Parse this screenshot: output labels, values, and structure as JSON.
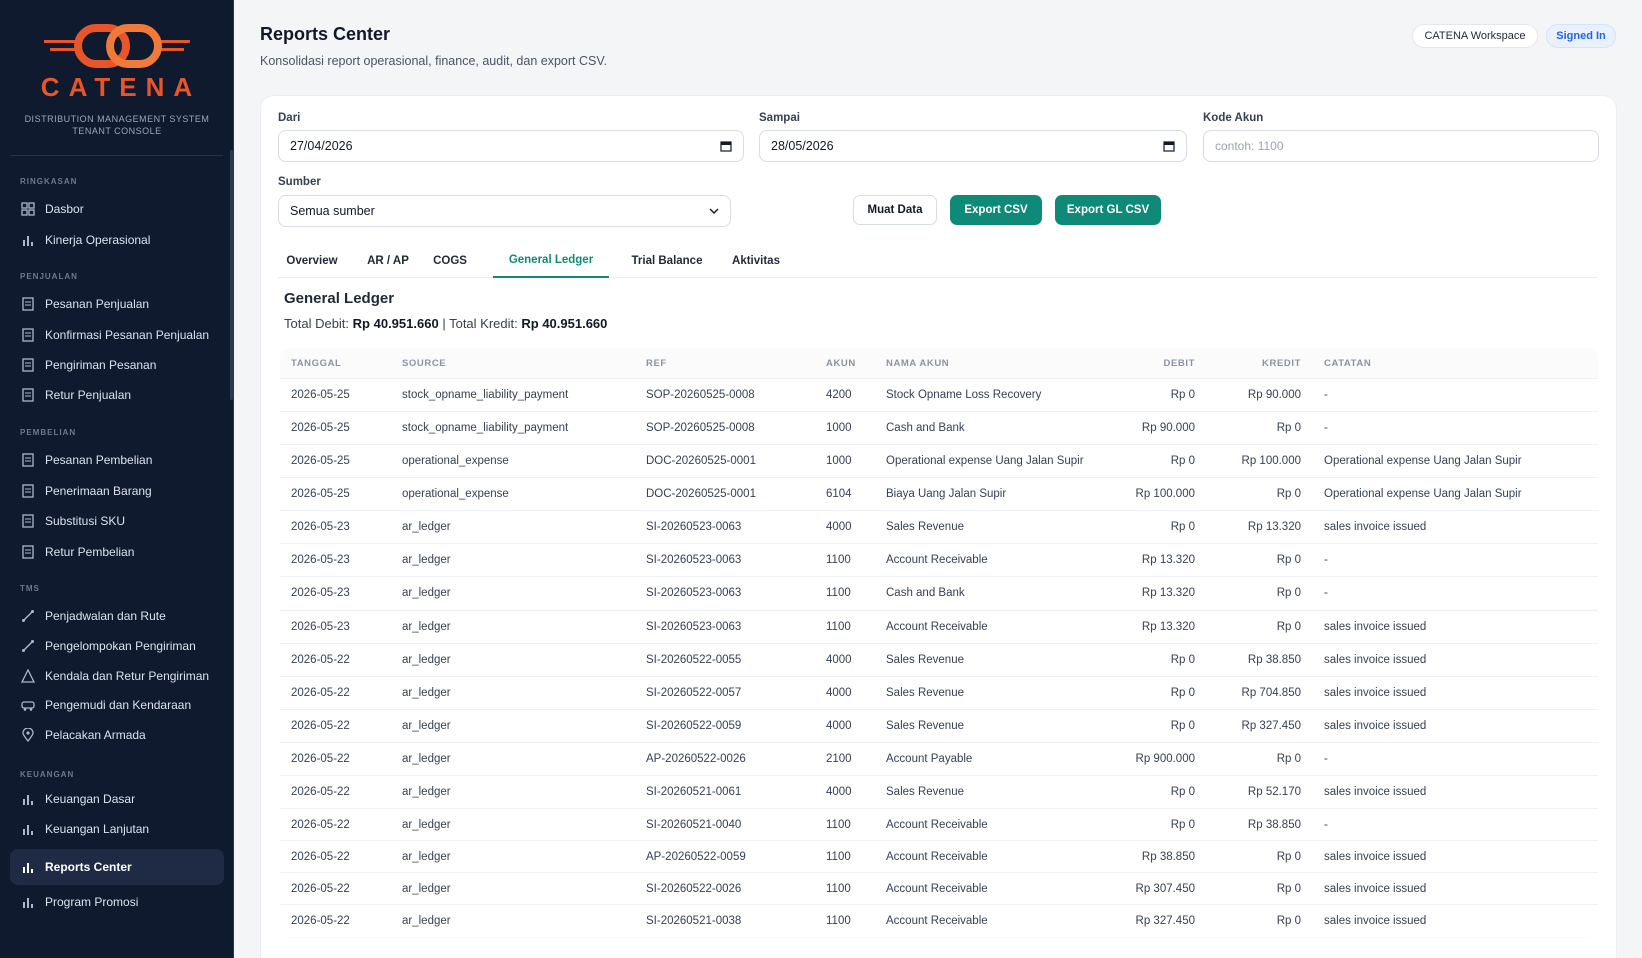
{
  "brand": {
    "name": "CATENA",
    "subtitle_line1": "DISTRIBUTION MANAGEMENT SYSTEM",
    "subtitle_line2": "TENANT CONSOLE",
    "accent_color": "#e8552b"
  },
  "sidebar": {
    "sections": [
      {
        "label": "RINGKASAN"
      },
      {
        "label": "PENJUALAN"
      },
      {
        "label": "PEMBELIAN"
      },
      {
        "label": "TMS"
      },
      {
        "label": "KEUANGAN"
      }
    ],
    "items": [
      {
        "label": "Dasbor",
        "icon": "grid-icon"
      },
      {
        "label": "Kinerja Operasional",
        "icon": "bar-chart-icon"
      },
      {
        "label": "Pesanan Penjualan",
        "icon": "document-icon"
      },
      {
        "label": "Konfirmasi Pesanan Penjualan",
        "icon": "document-icon"
      },
      {
        "label": "Pengiriman Pesanan",
        "icon": "document-icon"
      },
      {
        "label": "Retur Penjualan",
        "icon": "document-icon"
      },
      {
        "label": "Pesanan Pembelian",
        "icon": "document-icon"
      },
      {
        "label": "Penerimaan Barang",
        "icon": "document-icon"
      },
      {
        "label": "Substitusi SKU",
        "icon": "document-icon"
      },
      {
        "label": "Retur Pembelian",
        "icon": "document-icon"
      },
      {
        "label": "Penjadwalan dan Rute",
        "icon": "route-icon"
      },
      {
        "label": "Pengelompokan Pengiriman",
        "icon": "route-icon"
      },
      {
        "label": "Kendala dan Retur Pengiriman",
        "icon": "warning-icon"
      },
      {
        "label": "Pengemudi dan Kendaraan",
        "icon": "vehicle-icon"
      },
      {
        "label": "Pelacakan Armada",
        "icon": "location-pin-icon"
      },
      {
        "label": "Keuangan Dasar",
        "icon": "bar-chart-icon"
      },
      {
        "label": "Keuangan Lanjutan",
        "icon": "bar-chart-icon"
      },
      {
        "label": "Reports Center",
        "icon": "bar-chart-icon",
        "active": true
      },
      {
        "label": "Program Promosi",
        "icon": "bar-chart-icon"
      }
    ]
  },
  "header": {
    "title": "Reports Center",
    "subtitle": "Konsolidasi report operasional, finance, audit, dan export CSV.",
    "workspace": "CATENA Workspace",
    "status": "Signed In"
  },
  "filters": {
    "from_label": "Dari",
    "from_value": "27/04/2026",
    "to_label": "Sampai",
    "to_value": "28/05/2026",
    "account_label": "Kode Akun",
    "account_placeholder": "contoh: 1100",
    "source_label": "Sumber",
    "source_value": "Semua sumber"
  },
  "actions": {
    "load": "Muat Data",
    "export_csv": "Export CSV",
    "export_gl": "Export GL CSV",
    "accent_color": "#0f8a78"
  },
  "tabs": [
    {
      "label": "Overview"
    },
    {
      "label": "AR / AP"
    },
    {
      "label": "COGS"
    },
    {
      "label": "General Ledger",
      "active": true
    },
    {
      "label": "Trial Balance"
    },
    {
      "label": "Aktivitas"
    }
  ],
  "ledger": {
    "title": "General Ledger",
    "total_debit_label": "Total Debit:",
    "total_debit": "Rp 40.951.660",
    "separator": "|",
    "total_credit_label": "Total Kredit:",
    "total_credit": "Rp 40.951.660",
    "columns": [
      "TANGGAL",
      "SOURCE",
      "REF",
      "AKUN",
      "NAMA AKUN",
      "DEBIT",
      "KREDIT",
      "CATATAN"
    ],
    "rows": [
      [
        "2026-05-25",
        "stock_opname_liability_payment",
        "SOP-20260525-0008",
        "4200",
        "Stock Opname Loss Recovery",
        "Rp 0",
        "Rp 90.000",
        "-"
      ],
      [
        "2026-05-25",
        "stock_opname_liability_payment",
        "SOP-20260525-0008",
        "1000",
        "Cash and Bank",
        "Rp 90.000",
        "Rp 0",
        "-"
      ],
      [
        "2026-05-25",
        "operational_expense",
        "DOC-20260525-0001",
        "1000",
        "Operational expense Uang Jalan Supir",
        "Rp 0",
        "Rp 100.000",
        "Operational expense Uang Jalan Supir"
      ],
      [
        "2026-05-25",
        "operational_expense",
        "DOC-20260525-0001",
        "6104",
        "Biaya Uang Jalan Supir",
        "Rp 100.000",
        "Rp 0",
        "Operational expense Uang Jalan Supir"
      ],
      [
        "2026-05-23",
        "ar_ledger",
        "SI-20260523-0063",
        "4000",
        "Sales Revenue",
        "Rp 0",
        "Rp 13.320",
        "sales invoice issued"
      ],
      [
        "2026-05-23",
        "ar_ledger",
        "SI-20260523-0063",
        "1100",
        "Account Receivable",
        "Rp 13.320",
        "Rp 0",
        "-"
      ],
      [
        "2026-05-23",
        "ar_ledger",
        "SI-20260523-0063",
        "1100",
        "Cash and Bank",
        "Rp 13.320",
        "Rp 0",
        "-"
      ],
      [
        "2026-05-23",
        "ar_ledger",
        "SI-20260523-0063",
        "1100",
        "Account Receivable",
        "Rp 13.320",
        "Rp 0",
        "sales invoice issued"
      ],
      [
        "2026-05-22",
        "ar_ledger",
        "SI-20260522-0055",
        "4000",
        "Sales Revenue",
        "Rp 0",
        "Rp 38.850",
        "sales invoice issued"
      ],
      [
        "2026-05-22",
        "ar_ledger",
        "SI-20260522-0057",
        "4000",
        "Sales Revenue",
        "Rp 0",
        "Rp 704.850",
        "sales invoice issued"
      ],
      [
        "2026-05-22",
        "ar_ledger",
        "SI-20260522-0059",
        "4000",
        "Sales Revenue",
        "Rp 0",
        "Rp 327.450",
        "sales invoice issued"
      ],
      [
        "2026-05-22",
        "ar_ledger",
        "AP-20260522-0026",
        "2100",
        "Account Payable",
        "Rp 900.000",
        "Rp 0",
        "-"
      ],
      [
        "2026-05-22",
        "ar_ledger",
        "SI-20260521-0061",
        "4000",
        "Sales Revenue",
        "Rp 0",
        "Rp 52.170",
        "sales invoice issued"
      ],
      [
        "2026-05-22",
        "ar_ledger",
        "SI-20260521-0040",
        "1100",
        "Account Receivable",
        "Rp 0",
        "Rp 38.850",
        "-"
      ],
      [
        "2026-05-22",
        "ar_ledger",
        "AP-20260522-0059",
        "1100",
        "Account Receivable",
        "Rp 38.850",
        "Rp 0",
        "sales invoice issued"
      ],
      [
        "2026-05-22",
        "ar_ledger",
        "SI-20260522-0026",
        "1100",
        "Account Receivable",
        "Rp 307.450",
        "Rp 0",
        "sales invoice issued"
      ],
      [
        "2026-05-22",
        "ar_ledger",
        "SI-20260521-0038",
        "1100",
        "Account Receivable",
        "Rp 327.450",
        "Rp 0",
        "sales invoice issued"
      ]
    ]
  }
}
